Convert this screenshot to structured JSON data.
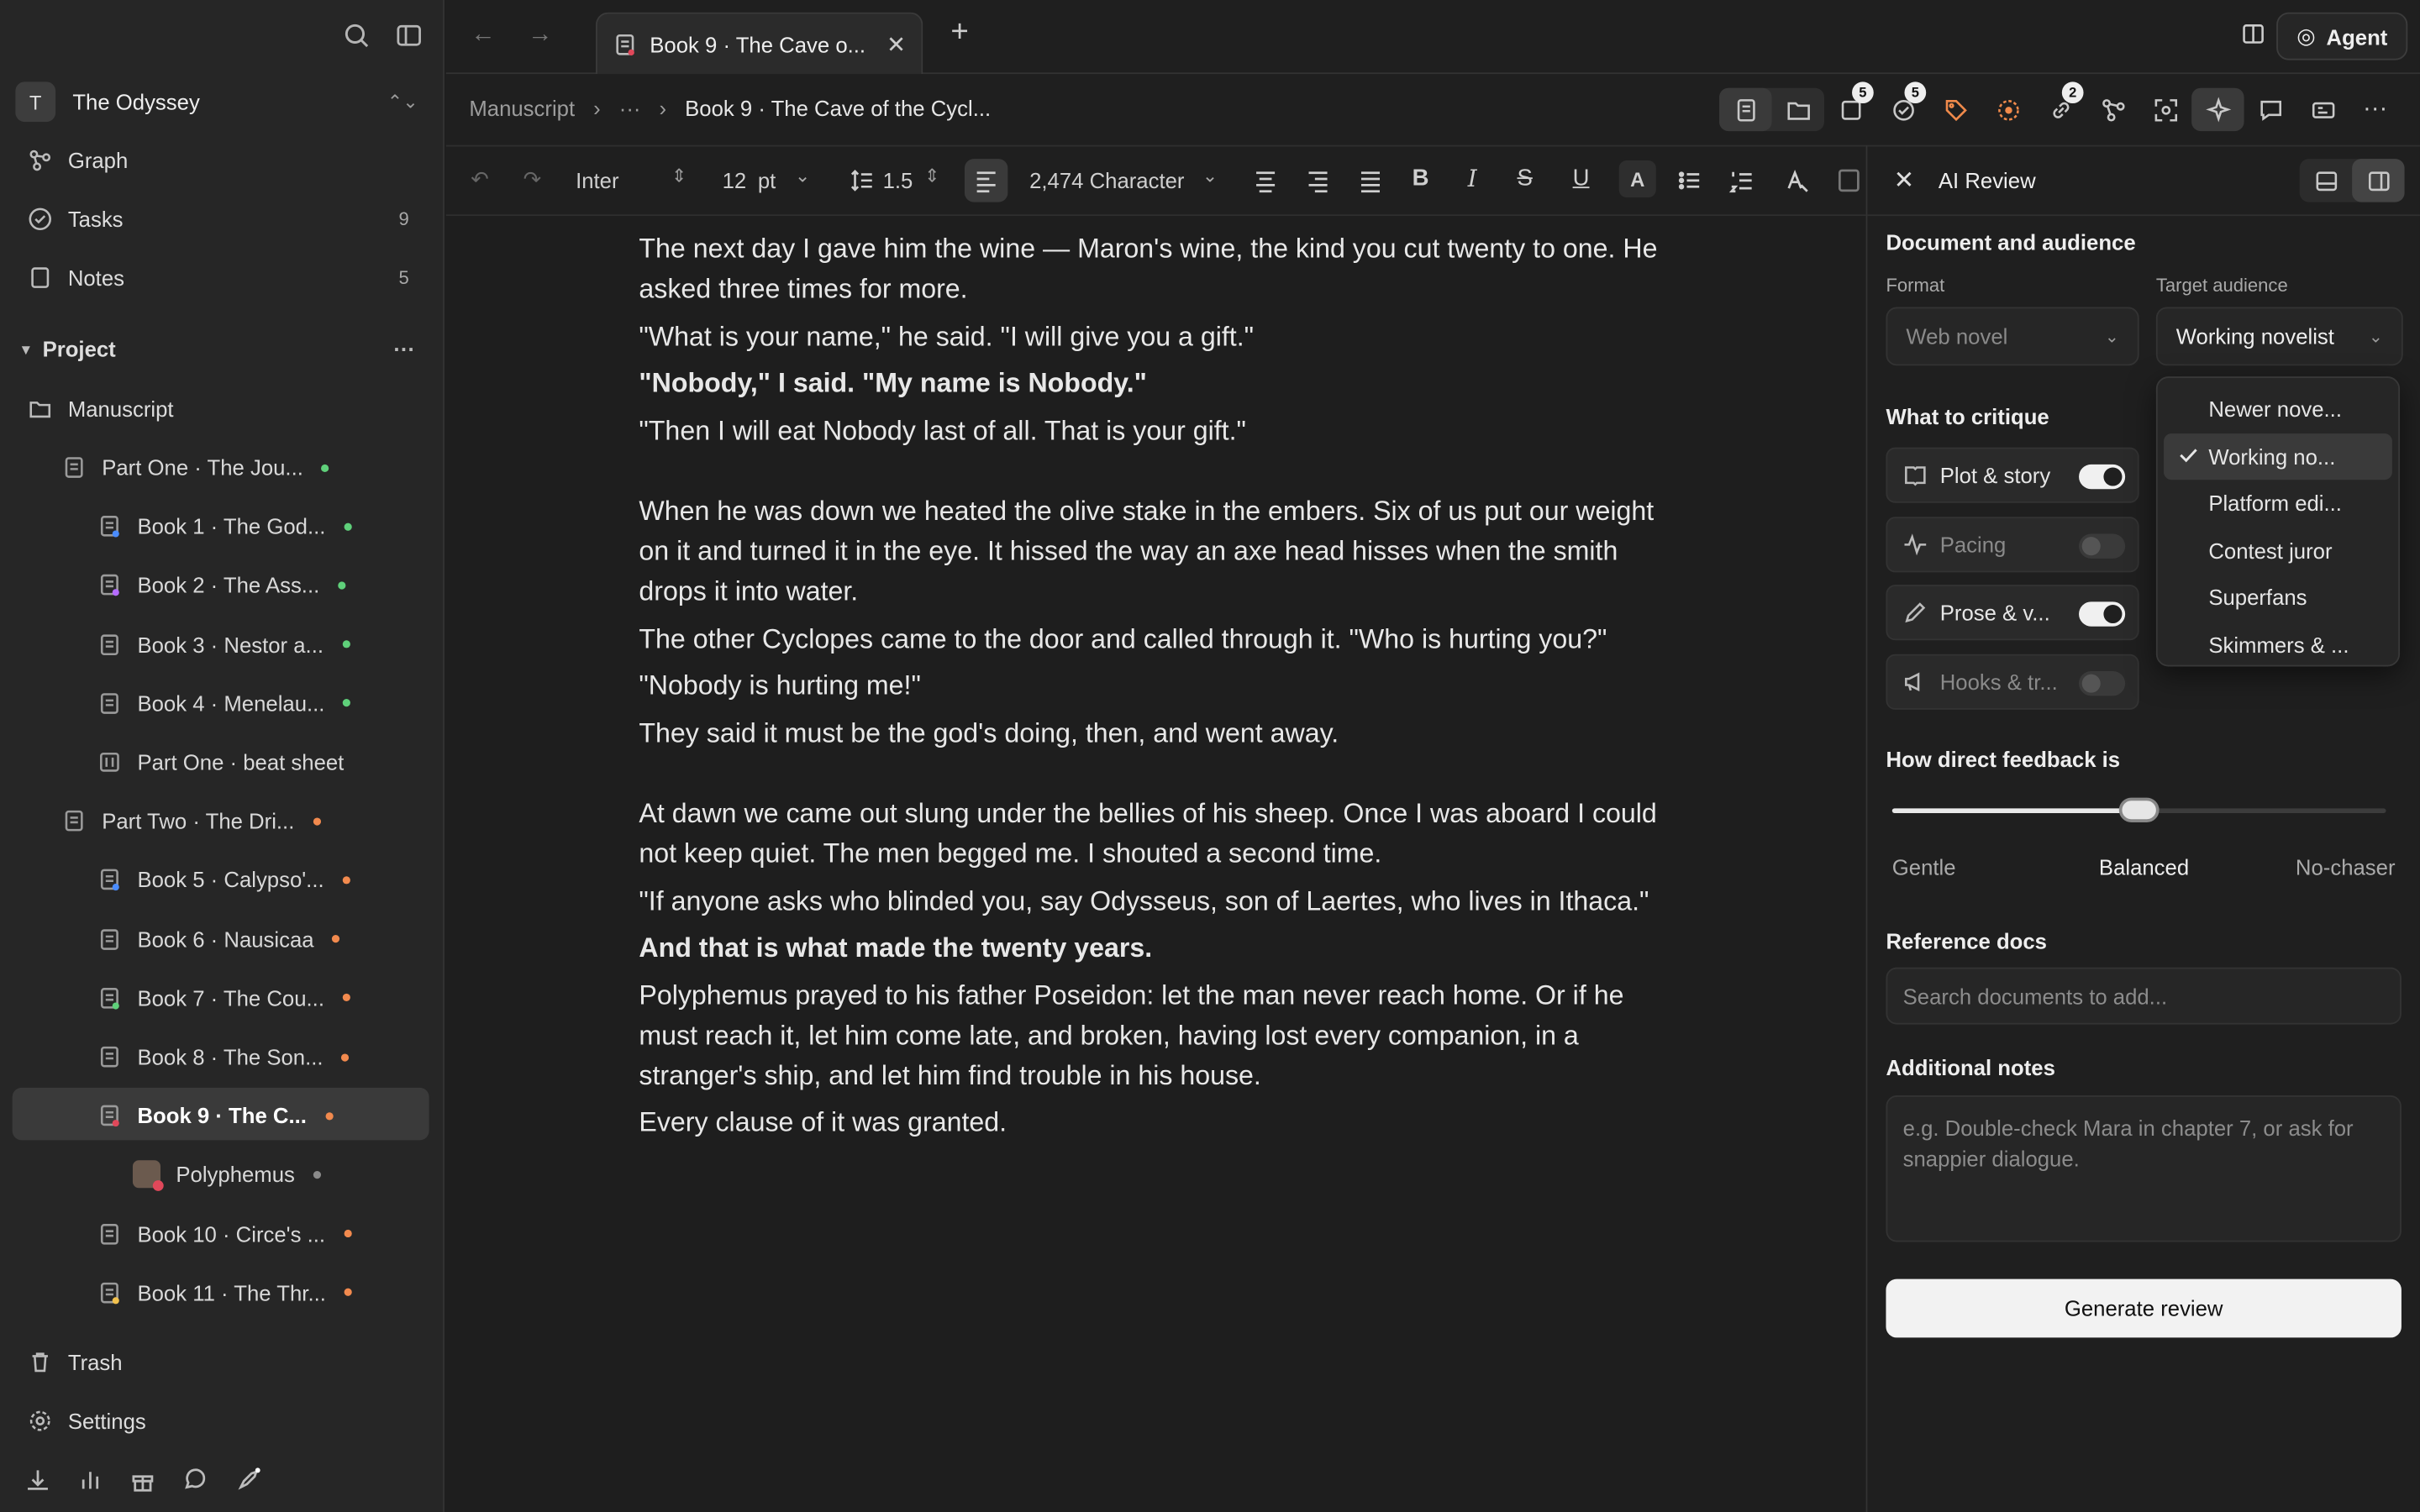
{
  "workspace": {
    "initial": "T",
    "name": "The Odyssey"
  },
  "nav": {
    "graph": "Graph",
    "tasks": "Tasks",
    "tasks_count": "9",
    "notes": "Notes",
    "notes_count": "5"
  },
  "project": {
    "label": "Project",
    "root": "Manuscript"
  },
  "tree": [
    {
      "label": "Part One · The Jou...",
      "dot": "g"
    },
    {
      "label": "Book 1 · The God...",
      "dot": "g"
    },
    {
      "label": "Book 2 · The Ass...",
      "dot": "g"
    },
    {
      "label": "Book 3 · Nestor a...",
      "dot": "g"
    },
    {
      "label": "Book 4 · Menelau...",
      "dot": "g"
    },
    {
      "label": "Part One · beat sheet",
      "dot": ""
    },
    {
      "label": "Part Two · The Dri...",
      "dot": "o"
    },
    {
      "label": "Book 5 · Calypso'...",
      "dot": "o"
    },
    {
      "label": "Book 6 · Nausicaa",
      "dot": "o"
    },
    {
      "label": "Book 7 · The Cou...",
      "dot": "o"
    },
    {
      "label": "Book 8 · The Son...",
      "dot": "o"
    },
    {
      "label": "Book 9 · The C...",
      "dot": "o"
    },
    {
      "label": "Polyphemus",
      "dot": "gray"
    },
    {
      "label": "Book 10 · Circe's ...",
      "dot": "o"
    },
    {
      "label": "Book 11 · The Thr...",
      "dot": "o"
    }
  ],
  "bottom_nav": {
    "trash": "Trash",
    "settings": "Settings"
  },
  "tab": {
    "title": "Book 9 · The Cave o...",
    "close": "✕",
    "new": "+"
  },
  "agent": {
    "label": "Agent"
  },
  "breadcrumb": {
    "root": "Manuscript",
    "ellipsis": "···",
    "current": "Book 9 · The Cave of the Cycl..."
  },
  "badges": {
    "pages": "5",
    "tasks": "5",
    "links": "2"
  },
  "format": {
    "font": "Inter",
    "size": "12",
    "unit": "pt",
    "line_height": "1.5",
    "count": "2,474 Character"
  },
  "document": {
    "paragraphs": [
      {
        "text": "The next day I gave him the wine — Maron's wine, the kind you cut twenty to one. He asked three times for more.",
        "bold": false
      },
      {
        "text": "\"What is your name,\" he said. \"I will give you a gift.\"",
        "bold": false
      },
      {
        "text": "\"Nobody,\" I said. \"My name is Nobody.\"",
        "bold": true
      },
      {
        "text": "\"Then I will eat Nobody last of all. That is your gift.\"",
        "bold": false
      },
      {
        "text": "",
        "gap": true
      },
      {
        "text": "When he was down we heated the olive stake in the embers. Six of us put our weight on it and turned it in the eye. It hissed the way an axe head hisses when the smith drops it into water.",
        "bold": false
      },
      {
        "text": "The other Cyclopes came to the door and called through it. \"Who is hurting you?\"",
        "bold": false
      },
      {
        "text": "\"Nobody is hurting me!\"",
        "bold": false
      },
      {
        "text": "They said it must be the god's doing, then, and went away.",
        "bold": false
      },
      {
        "text": "",
        "gap": true
      },
      {
        "text": "At dawn we came out slung under the bellies of his sheep. Once I was aboard I could not keep quiet. The men begged me. I shouted a second time.",
        "bold": false
      },
      {
        "text": "\"If anyone asks who blinded you, say Odysseus, son of Laertes, who lives in Ithaca.\"",
        "bold": false
      },
      {
        "text": "And that is what made the twenty years.",
        "bold": true
      },
      {
        "text": "Polyphemus prayed to his father Poseidon: let the man never reach home. Or if he must reach it, let him come late, and broken, having lost every companion, in a stranger's ship, and let him find trouble in his house.",
        "bold": false
      },
      {
        "text": "Every clause of it was granted.",
        "bold": false
      }
    ]
  },
  "panel": {
    "title": "AI Review",
    "section_doc": "Document and audience",
    "format_label": "Format",
    "format_value": "Web novel",
    "audience_label": "Target audience",
    "audience_value": "Working novelist",
    "critique_title": "What to critique",
    "critique": [
      {
        "label": "Plot & story",
        "on": true
      },
      {
        "label": "Pacing",
        "on": false
      },
      {
        "label": "Prose & v...",
        "on": true
      },
      {
        "label": "Hooks & tr...",
        "on": false
      }
    ],
    "feedback_title": "How direct feedback is",
    "feedback_value": 0.5,
    "feedback_labels": [
      "Gentle",
      "Balanced",
      "No-chaser"
    ],
    "ref_title": "Reference docs",
    "ref_placeholder": "Search documents to add...",
    "notes_title": "Additional notes",
    "notes_placeholder": "e.g. Double-check Mara in chapter 7, or ask for snappier dialogue.",
    "generate": "Generate review"
  },
  "audience_options": [
    "Newer nove...",
    "Working no...",
    "Platform edi...",
    "Contest juror",
    "Superfans",
    "Skimmers & ..."
  ],
  "audience_selected_index": 1
}
